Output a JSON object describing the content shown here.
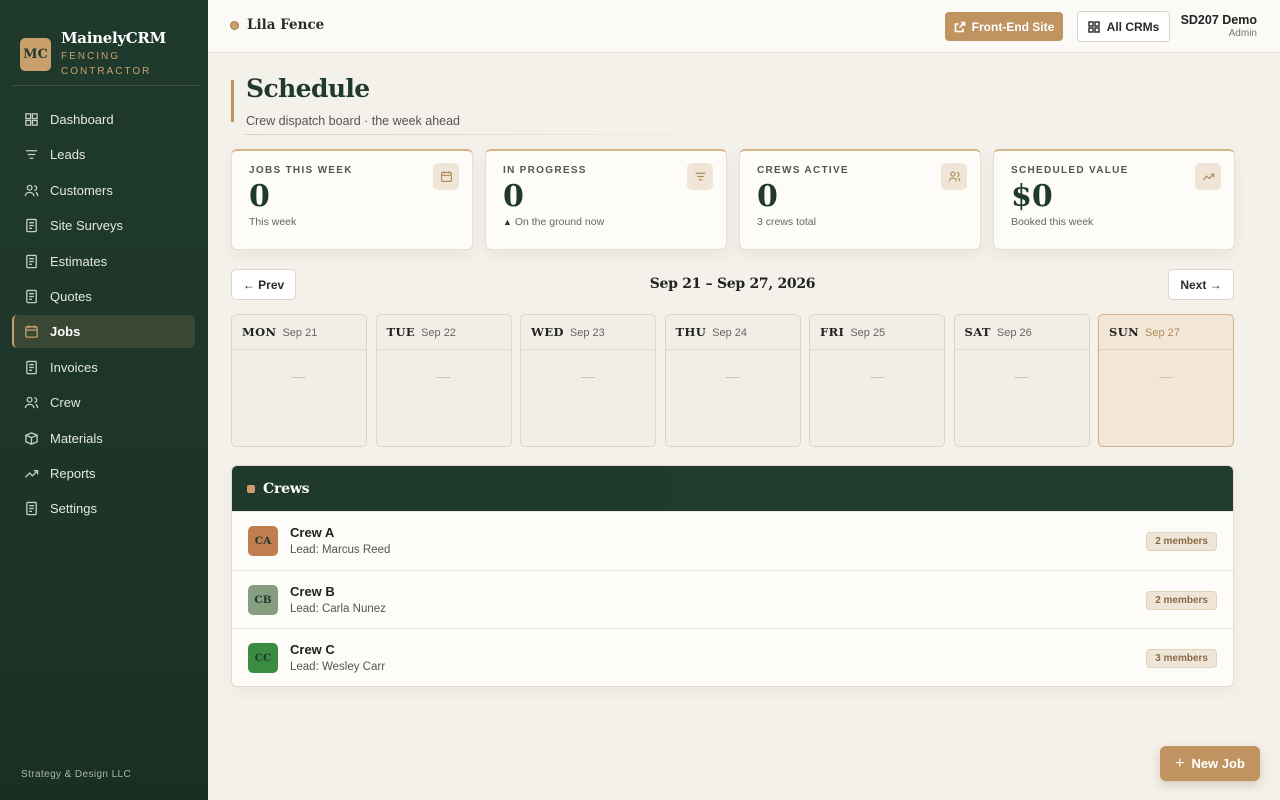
{
  "brand": {
    "logo": "MC",
    "name": "MainelyCRM",
    "sub1": "FENCING",
    "sub2": "CONTRACTOR"
  },
  "nav": [
    {
      "label": "Dashboard",
      "icon": "grid-icon"
    },
    {
      "label": "Leads",
      "icon": "filter-icon"
    },
    {
      "label": "Customers",
      "icon": "users-icon"
    },
    {
      "label": "Site Surveys",
      "icon": "document-icon"
    },
    {
      "label": "Estimates",
      "icon": "document-icon"
    },
    {
      "label": "Quotes",
      "icon": "document-icon"
    },
    {
      "label": "Jobs",
      "icon": "calendar-icon",
      "active": true
    },
    {
      "label": "Invoices",
      "icon": "document-icon"
    },
    {
      "label": "Crew",
      "icon": "users-icon"
    },
    {
      "label": "Materials",
      "icon": "box-icon"
    },
    {
      "label": "Reports",
      "icon": "trend-icon"
    },
    {
      "label": "Settings",
      "icon": "document-icon"
    }
  ],
  "footer": "Strategy & Design LLC",
  "topbar": {
    "client": "Lila Fence",
    "frontend_label": "Front-End Site",
    "allcrm_label": "All CRMs",
    "user_name": "SD207 Demo",
    "user_role": "Admin"
  },
  "page": {
    "title": "Schedule",
    "subtitle": "Crew dispatch board · the week ahead"
  },
  "stats": [
    {
      "label": "JOBS THIS WEEK",
      "value": "0",
      "sub": "This week",
      "icon": "calendar-icon"
    },
    {
      "label": "IN PROGRESS",
      "value": "0",
      "sub": "On the ground now",
      "sub_prefix": "▲",
      "icon": "filter-icon"
    },
    {
      "label": "CREWS ACTIVE",
      "value": "0",
      "sub": "3 crews total",
      "icon": "users-icon"
    },
    {
      "label": "SCHEDULED VALUE",
      "value": "$0",
      "sub": "Booked this week",
      "icon": "trend-icon"
    }
  ],
  "week": {
    "prev_label": "← Prev",
    "next_label": "Next →",
    "range": "Sep 21 – Sep 27, 2026"
  },
  "days": [
    {
      "name": "MON",
      "date": "Sep 21",
      "empty": "—"
    },
    {
      "name": "TUE",
      "date": "Sep 22",
      "empty": "—"
    },
    {
      "name": "WED",
      "date": "Sep 23",
      "empty": "—"
    },
    {
      "name": "THU",
      "date": "Sep 24",
      "empty": "—"
    },
    {
      "name": "FRI",
      "date": "Sep 25",
      "empty": "—"
    },
    {
      "name": "SAT",
      "date": "Sep 26",
      "empty": "—"
    },
    {
      "name": "SUN",
      "date": "Sep 27",
      "empty": "—",
      "today": true
    }
  ],
  "crews": {
    "title": "Crews",
    "items": [
      {
        "initials": "CA",
        "name": "Crew A",
        "lead": "Lead: Marcus Reed",
        "members": "2 members",
        "color": "#c07e4f"
      },
      {
        "initials": "CB",
        "name": "Crew B",
        "lead": "Lead: Carla Nunez",
        "members": "2 members",
        "color": "#879d80"
      },
      {
        "initials": "CC",
        "name": "Crew C",
        "lead": "Lead: Wesley Carr",
        "members": "3 members",
        "color": "#3b8c43"
      }
    ]
  },
  "fab": {
    "label": "New Job",
    "plus": "+"
  },
  "colors": {
    "sidebar": "#1f3a2c",
    "accent": "#c09461",
    "background": "#f4f1ea"
  }
}
